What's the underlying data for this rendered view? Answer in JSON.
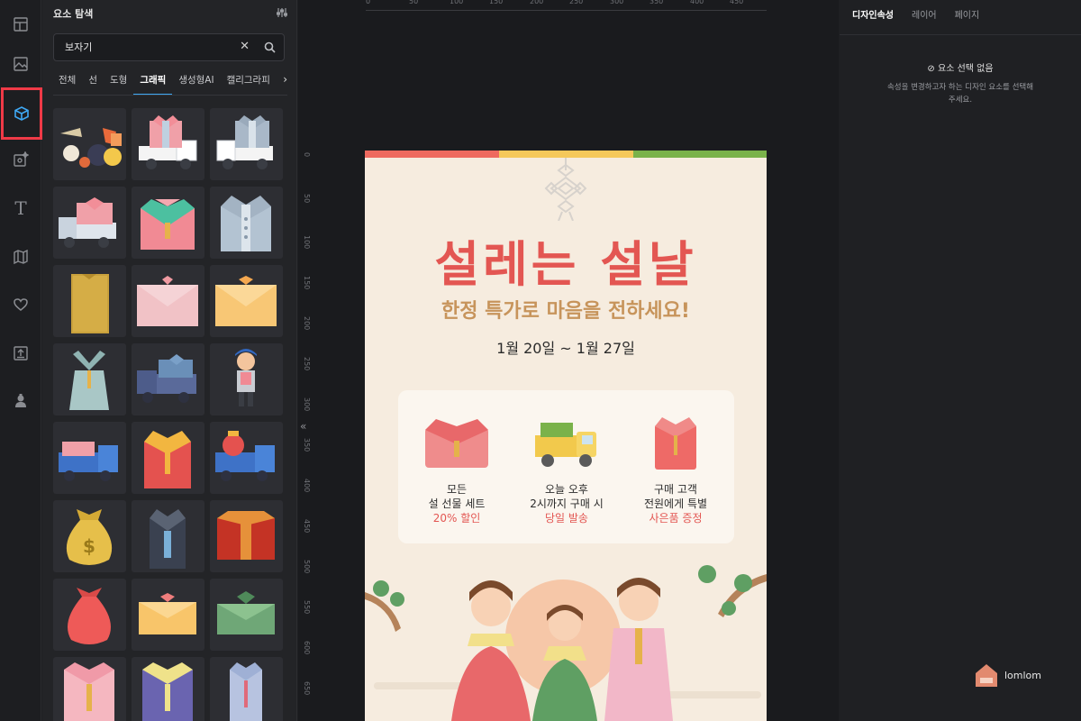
{
  "rail": {
    "items": [
      {
        "name": "templates-icon"
      },
      {
        "name": "photo-icon"
      },
      {
        "name": "elements-icon",
        "active": true
      },
      {
        "name": "ai-image-icon"
      },
      {
        "name": "text-icon",
        "glyph": "T"
      },
      {
        "name": "map-icon"
      },
      {
        "name": "heart-icon"
      },
      {
        "name": "upload-icon"
      },
      {
        "name": "character-icon"
      }
    ]
  },
  "panel": {
    "title": "요소 탐색",
    "search_value": "보자기",
    "tabs": [
      "전체",
      "선",
      "도형",
      "그래픽",
      "생성형AI",
      "캘리그라피"
    ],
    "active_tab": "그래픽"
  },
  "canvas": {
    "ruler_top": [
      "0",
      "50",
      "100",
      "150",
      "200",
      "250",
      "300",
      "350",
      "400",
      "450"
    ],
    "ruler_left": [
      "0",
      "50",
      "100",
      "150",
      "200",
      "250",
      "300",
      "350",
      "400",
      "450",
      "500",
      "550",
      "600",
      "650"
    ]
  },
  "poster": {
    "title": "설레는 설날",
    "subtitle": "한정 특가로 마음을 전하세요!",
    "date": "1월 20일 ~ 1월 27일",
    "features": [
      {
        "line1": "모든",
        "line2": "설 선물 세트",
        "highlight": "20% 할인"
      },
      {
        "line1": "오늘 오후",
        "line2": "2시까지 구매 시",
        "highlight": "당일 발송"
      },
      {
        "line1": "구매 고객",
        "line2": "전원에게 특별",
        "highlight": "사은품 증정"
      }
    ],
    "colors": {
      "red": "#e35652",
      "gold": "#c7945b",
      "yellow": "#f5c85a",
      "green": "#7ab24a"
    }
  },
  "props": {
    "tabs": [
      "디자인속성",
      "레이어",
      "페이지"
    ],
    "active_tab": "디자인속성",
    "no_selection": "요소 선택 없음",
    "no_selection_desc": "속성을 변경하고자 하는 디자인 요소를 선택해주세요.",
    "logo_text": "lomlom"
  }
}
